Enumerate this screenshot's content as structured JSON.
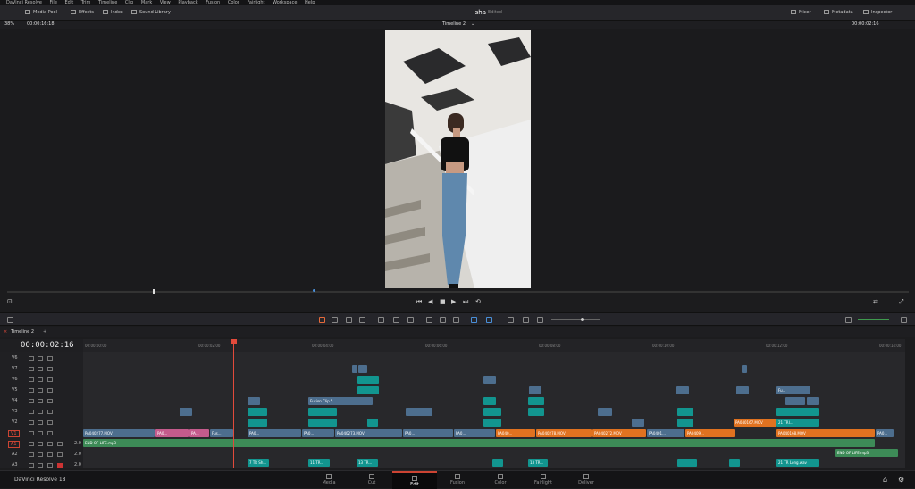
{
  "menu": [
    "DaVinci Resolve",
    "File",
    "Edit",
    "Trim",
    "Timeline",
    "Clip",
    "Mark",
    "View",
    "Playback",
    "Fusion",
    "Color",
    "Fairlight",
    "Workspace",
    "Help"
  ],
  "toolbar": {
    "media_pool": "Media Pool",
    "effects": "Effects",
    "index": "Index",
    "sound_library": "Sound Library",
    "project": "sha",
    "status": "Edited",
    "mixer": "Mixer",
    "metadata": "Metadata",
    "inspector": "Inspector"
  },
  "viewer": {
    "zoom": "38%",
    "duration": "00:00:16:18",
    "timeline": "Timeline 2",
    "timecode": "00:00:02:16"
  },
  "timeline": {
    "tab": "Timeline 2",
    "timecode": "00:00:02:16",
    "ruler": [
      "00:00:00:00",
      "00:00:02:00",
      "00:00:04:00",
      "00:00:06:00",
      "00:00:08:00",
      "00:00:10:00",
      "00:00:12:00",
      "00:00:14:00"
    ],
    "tracks": [
      "V6",
      "V7",
      "V6",
      "V5",
      "V4",
      "V3",
      "V2",
      "V1",
      "A1",
      "A2",
      "A3"
    ],
    "audio_channels": [
      "2.0",
      "2.0",
      "2.0"
    ],
    "clips": {
      "v1_1": "PA040277.MOV",
      "v1_2": "PA0...",
      "v1_3": "PA...",
      "v1_4": "Fus...",
      "v1_5": "PA0...",
      "v1_6": "PA0...",
      "v1_7": "PA040273.MOV",
      "v1_8": "PA0...",
      "v1_9": "PA0...",
      "v1_10": "PA040...",
      "v1_11": "PA040278.MOV",
      "v1_12": "PA040272.MOV",
      "v1_13": "PA0401...",
      "v1_14": "PA0409...",
      "v1_15": "PA040168.MOV",
      "v1_16": "PA0...",
      "v2_orange": "PA040167.MOV",
      "v2_tea": "21 TRI...",
      "v4_fusion": "Fusion Clip 5",
      "v5_fu": "Fu...",
      "a1": "END OF LIFE.mp3",
      "a2": "END OF LIFE.mp3",
      "a3_1": "7 TR Sh...",
      "a3_2": "11 TR...",
      "a3_3": "13 TR...",
      "a3_4": "13 TR...",
      "a3_5": "21 TR Long.wav"
    }
  },
  "footer": {
    "app": "DaVinci Resolve 18",
    "pages": [
      "Media",
      "Cut",
      "Edit",
      "Fusion",
      "Color",
      "Fairlight",
      "Deliver"
    ],
    "active": "Edit"
  }
}
